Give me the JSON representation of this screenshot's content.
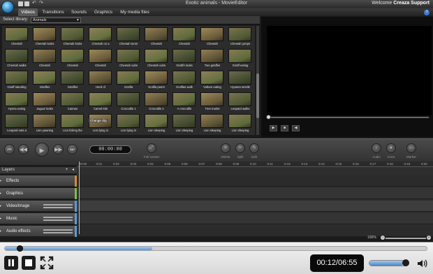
{
  "window": {
    "title": "Exotic animals - MovieEditor",
    "welcome_text": "Welcome",
    "welcome_user": "Creaza Support"
  },
  "tabs": [
    {
      "label": "Videos",
      "active": true
    },
    {
      "label": "Transitions",
      "active": false
    },
    {
      "label": "Sounds",
      "active": false
    },
    {
      "label": "Graphics",
      "active": false
    },
    {
      "label": "My media files",
      "active": false
    }
  ],
  "library": {
    "label": "Select library:",
    "selected": "Animals"
  },
  "clips": [
    "Cheetah",
    "Cheetah looks",
    "Cheetah looks",
    "Cheetah on a",
    "Cheetah turns",
    "Cheetah",
    "Cheetah",
    "Cheetah",
    "Cheetah jumps",
    "Cheetah walks",
    "Cheetah",
    "Cheetah",
    "Cheetah",
    "Cheetah cubs",
    "Cheetah cubs",
    "Giraffe looks",
    "Two giraffes",
    "Giraff eating",
    "Giraff standing",
    "Giraffes",
    "Giraffes",
    "Herd of",
    "Gorilla",
    "Gorilla peers",
    "Gorillas walk",
    "Vulture eating",
    "Hyaena smells",
    "Hyena eating",
    "Jaguar looks",
    "Caiman",
    "Camel ride",
    "Crocodile 1",
    "Crocodile 2",
    "A crocodile",
    "Tree trunks",
    "Leopard walks",
    "Leopard eats a",
    "Lion yawning",
    "Lion licking the",
    "Lion lying in",
    "Lion lying in",
    "Lion sleeping",
    "Lion sleeping",
    "Lion sleeping",
    "Lion sleeping"
  ],
  "clip_tooltip": "Change clip",
  "timecode": "00:00:00",
  "tools": {
    "fullscreen": "Full screen",
    "delete": "Delete",
    "split": "Split",
    "edit": "Edit",
    "audio": "Audio",
    "voice": "Voice",
    "marker": "Marker"
  },
  "ruler_ticks": [
    "00:00",
    "0:01",
    "0:02",
    "0:03",
    "0:04",
    "0:05",
    "0:06",
    "0:07",
    "0:08",
    "0:09",
    "0:10",
    "0:11",
    "0:12",
    "0:13",
    "0:14",
    "0:15",
    "0:16",
    "0:17",
    "0:18",
    "0:19",
    "0:20"
  ],
  "layers": {
    "header": "Layers",
    "items": [
      {
        "name": "Effects",
        "color": "#d98a3a"
      },
      {
        "name": "Graphics",
        "color": "#7cbf4a"
      },
      {
        "name": "Video/image",
        "color": "#5b9bd5"
      },
      {
        "name": "Music",
        "color": "#5b9bd5"
      },
      {
        "name": "Audio effects",
        "color": "#5b9bd5"
      }
    ]
  },
  "zoom": {
    "label": "100%"
  },
  "player": {
    "time": "00:12/06:55",
    "progress": 0.35,
    "volume": 0.85
  },
  "colors": {
    "accent": "#5c98d4",
    "timeline_bg": "#2e2e2e"
  }
}
